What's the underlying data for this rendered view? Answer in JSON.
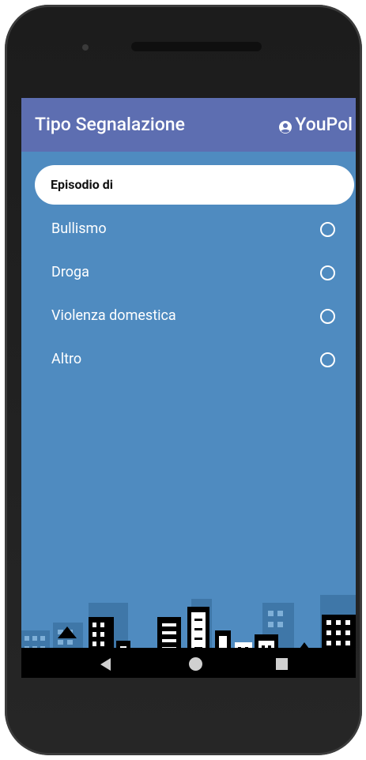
{
  "appbar": {
    "title": "Tipo Segnalazione",
    "brand": "YouPol",
    "brand_icon": "account-circle-icon",
    "color": "#5d6eb1"
  },
  "section": {
    "label": "Episodio di"
  },
  "options": [
    {
      "label": "Bullismo",
      "selected": false
    },
    {
      "label": "Droga",
      "selected": false
    },
    {
      "label": "Violenza domestica",
      "selected": false
    },
    {
      "label": "Altro",
      "selected": false
    }
  ],
  "background_color": "#4f8bc0",
  "navbar": {
    "back": "back-icon",
    "home": "home-icon",
    "recents": "recents-icon"
  }
}
